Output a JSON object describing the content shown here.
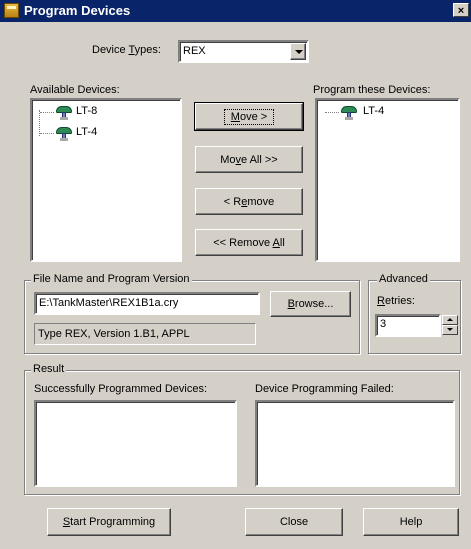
{
  "window": {
    "title": "Program Devices",
    "close_glyph": "×"
  },
  "device_types": {
    "label_pre": "Device ",
    "label_accel": "T",
    "label_post": "ypes:",
    "selected": "REX"
  },
  "available": {
    "label": "Available Devices:",
    "items": [
      "LT-8",
      "LT-4"
    ]
  },
  "program": {
    "label": "Program these Devices:",
    "items": [
      "LT-4"
    ]
  },
  "buttons": {
    "move": {
      "pre": "",
      "accel": "M",
      "post": "ove >"
    },
    "move_all": {
      "pre": "Mo",
      "accel": "v",
      "post": "e All >>"
    },
    "remove": {
      "pre": "< R",
      "accel": "e",
      "post": "move"
    },
    "remove_all": {
      "pre": "<< Remove ",
      "accel": "A",
      "post": "ll"
    },
    "browse": {
      "pre": "",
      "accel": "B",
      "post": "rowse..."
    },
    "start": {
      "pre": "",
      "accel": "S",
      "post": "tart Programming"
    },
    "close": "Close",
    "help": "Help"
  },
  "file": {
    "group_label": "File Name and Program Version",
    "path": "E:\\TankMaster\\REX1B1a.cry",
    "version": "Type REX, Version 1.B1, APPL"
  },
  "advanced": {
    "group_label": "Advanced",
    "retries_accel": "R",
    "retries_post": "etries:",
    "retries_value": "3"
  },
  "result": {
    "group_label": "Result",
    "success_label": "Successfully Programmed Devices:",
    "failed_label": "Device Programming Failed:"
  }
}
